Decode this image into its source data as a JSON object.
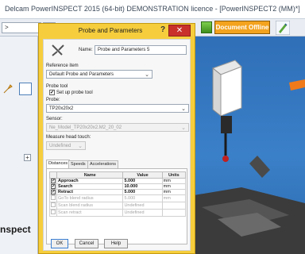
{
  "app": {
    "title": "Delcam PowerINSPECT 2015 (64-bit) DEMONSTRATION licence - [PowerINSPECT2 (MM)*]",
    "toolbar_combo_value": ">",
    "toolbar_combo2_value": "",
    "document_status": "Document Offline",
    "left_panel_label": "nspect"
  },
  "dialog": {
    "title": "Probe and Parameters",
    "help_symbol": "?",
    "close_symbol": "✕",
    "name_label": "Name:",
    "name_value": "Probe and Parameters 5",
    "reference_item_label": "Reference item",
    "reference_item_value": "Default Probe and Parameters",
    "probe_tool_label": "Probe tool",
    "setup_probe_tool_label": "Set up probe tool",
    "setup_probe_tool_checked": true,
    "probe_label": "Probe:",
    "probe_value": "TP20x20x2",
    "sensor_label": "Sensor:",
    "sensor_value": "Ne_Model_TP20x20x2.M2_20_02",
    "measure_head_touch_label": "Measure head touch:",
    "measure_head_touch_value": "Undefined",
    "tabs": [
      "Distances",
      "Speeds",
      "Accelerations"
    ],
    "active_tab": "Distances",
    "table": {
      "headers": [
        "Name",
        "Value",
        "Units"
      ],
      "rows": [
        {
          "checked": true,
          "name": "Approach",
          "value": "5.000",
          "units": "mm",
          "enabled": true
        },
        {
          "checked": true,
          "name": "Search",
          "value": "10.000",
          "units": "mm",
          "enabled": true
        },
        {
          "checked": true,
          "name": "Retract",
          "value": "5.000",
          "units": "mm",
          "enabled": true
        },
        {
          "checked": false,
          "name": "GoTo blend radius",
          "value": "5.000",
          "units": "mm",
          "enabled": false
        },
        {
          "checked": false,
          "name": "Scan blend radius",
          "value": "Undefined",
          "units": "",
          "enabled": false
        },
        {
          "checked": false,
          "name": "Scan retract",
          "value": "Undefined",
          "units": "",
          "enabled": false
        }
      ]
    },
    "buttons": {
      "ok": "OK",
      "cancel": "Cancel",
      "help": "Help"
    }
  },
  "colors": {
    "dialog_accent": "#f6ce3d",
    "close_button": "#c9302c",
    "document_offline": "#f3a31e",
    "viewport_background": "#3a80c8"
  }
}
